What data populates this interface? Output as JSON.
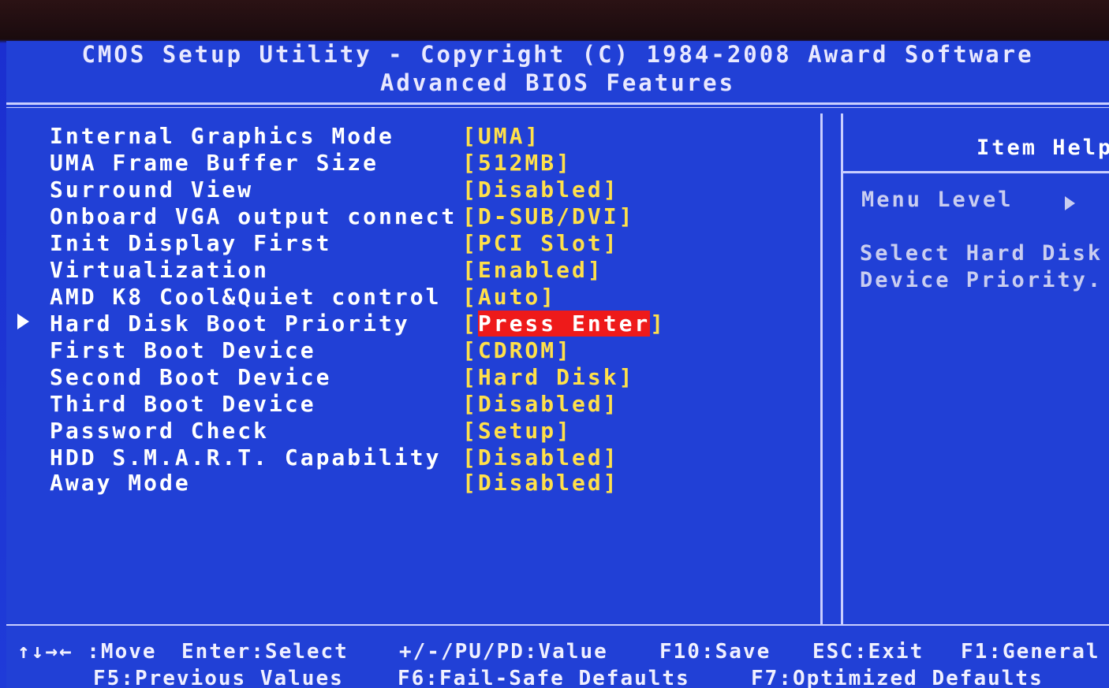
{
  "header": {
    "title": "CMOS Setup Utility - Copyright (C) 1984-2008 Award Software",
    "subtitle": "Advanced BIOS Features"
  },
  "items": [
    {
      "label": "Internal Graphics Mode",
      "value": "[UMA]"
    },
    {
      "label": "UMA Frame Buffer Size",
      "value": "[512MB]"
    },
    {
      "label": "Surround View",
      "value": "[Disabled]"
    },
    {
      "label": "Onboard VGA output connect",
      "value": "[D-SUB/DVI]"
    },
    {
      "label": "Init Display First",
      "value": "[PCI Slot]"
    },
    {
      "label": "Virtualization",
      "value": "[Enabled]"
    },
    {
      "label": "AMD K8 Cool&Quiet control",
      "value": "[Auto]"
    },
    {
      "label": "Hard Disk Boot Priority",
      "value_open": "[",
      "value_selected": "Press Enter",
      "value_close": "]",
      "submenu": true,
      "selected": true
    },
    {
      "label": "First Boot Device",
      "value": "[CDROM]"
    },
    {
      "label": "Second Boot Device",
      "value": "[Hard Disk]"
    },
    {
      "label": "Third Boot Device",
      "value": "[Disabled]"
    },
    {
      "label": "Password Check",
      "value": "[Setup]"
    },
    {
      "label": "HDD S.M.A.R.T. Capability",
      "value": "[Disabled]"
    },
    {
      "label": "Away Mode",
      "value": "[Disabled]"
    }
  ],
  "help": {
    "title": "Item Help",
    "menu_level": "Menu Level",
    "menu_level_icon": "right-triangle-icon",
    "description_line1": "Select Hard Disk",
    "description_line2": "Device Priority."
  },
  "footer": {
    "move": "↑↓→← :Move",
    "enter": "Enter:Select",
    "value": "+/-/PU/PD:Value",
    "save": "F10:Save",
    "exit": "ESC:Exit",
    "general": "F1:General",
    "previous": "F5:Previous Values",
    "failsafe": "F6:Fail-Safe Defaults",
    "optimized": "F7:Optimized Defaults"
  },
  "colors": {
    "background": "#2140d6",
    "label": "#ffffff",
    "value": "#ffe04a",
    "highlight": "#ee1a1a",
    "help_text": "#c9cdf0"
  }
}
